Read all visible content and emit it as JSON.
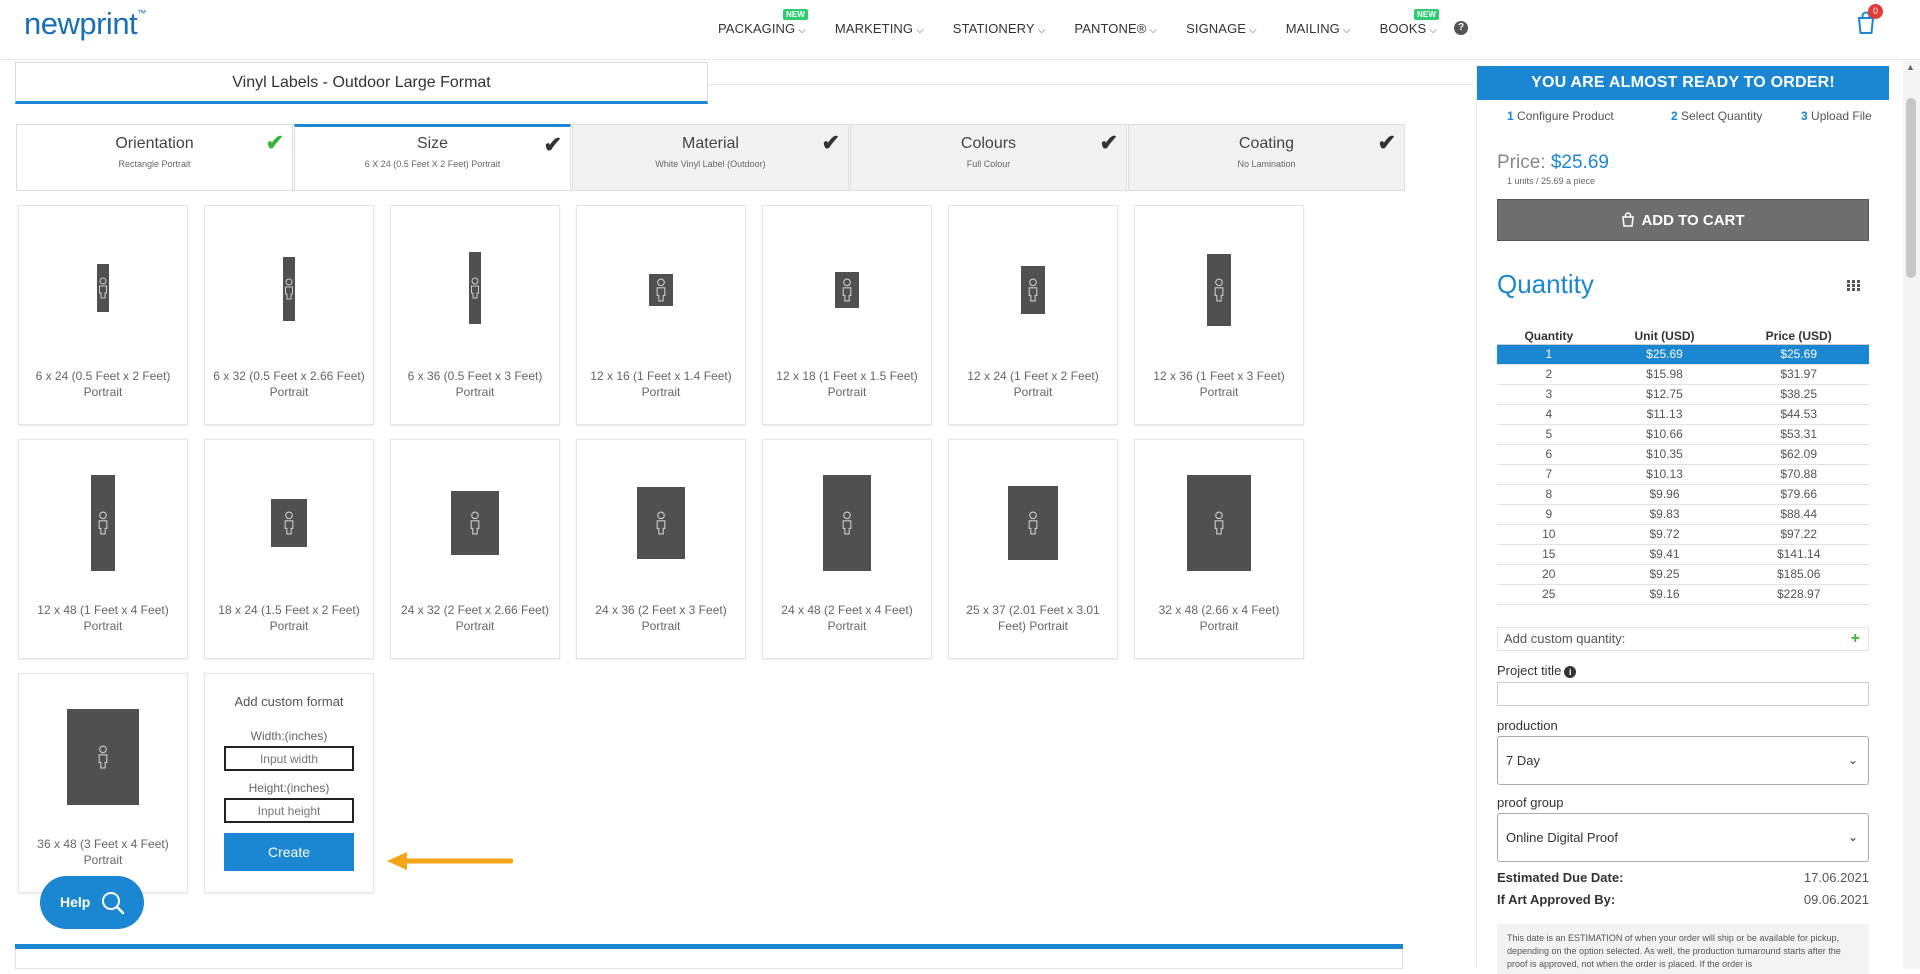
{
  "header": {
    "logo": "newprint",
    "logo_tm": "™",
    "nav": [
      {
        "label": "PACKAGING",
        "badge": "NEW"
      },
      {
        "label": "MARKETING",
        "badge": ""
      },
      {
        "label": "STATIONERY",
        "badge": ""
      },
      {
        "label": "PANTONE®",
        "badge": ""
      },
      {
        "label": "SIGNAGE",
        "badge": ""
      },
      {
        "label": "MAILING",
        "badge": ""
      },
      {
        "label": "BOOKS",
        "badge": "NEW"
      }
    ],
    "help_icon": "?",
    "cart_count": "0"
  },
  "product": {
    "title": "Vinyl Labels - Outdoor Large Format"
  },
  "steps": [
    {
      "title": "Orientation",
      "sub": "Rectangle Portrait"
    },
    {
      "title": "Size",
      "sub": "6 X 24 (0.5 Feet X 2 Feet) Portrait"
    },
    {
      "title": "Material",
      "sub": "White Vinyl Label (Outdoor)"
    },
    {
      "title": "Colours",
      "sub": "Full Colour"
    },
    {
      "title": "Coating",
      "sub": "No Lamination"
    }
  ],
  "sizes": [
    {
      "line1": "6 x 24 (0.5 Feet x 2 Feet)",
      "line2": "Portrait"
    },
    {
      "line1": "6 x 32 (0.5 Feet x 2.66 Feet)",
      "line2": "Portrait"
    },
    {
      "line1": "6 x 36 (0.5 Feet x 3 Feet)",
      "line2": "Portrait"
    },
    {
      "line1": "12 x 16 (1 Feet x 1.4 Feet)",
      "line2": "Portrait"
    },
    {
      "line1": "12 x 18 (1 Feet x 1.5 Feet)",
      "line2": "Portrait"
    },
    {
      "line1": "12 x 24 (1 Feet x 2 Feet)",
      "line2": "Portrait"
    },
    {
      "line1": "12 x 36 (1 Feet x 3 Feet)",
      "line2": "Portrait"
    },
    {
      "line1": "12 x 48 (1 Feet x 4 Feet)",
      "line2": "Portrait"
    },
    {
      "line1": "18 x 24 (1.5 Feet x 2 Feet)",
      "line2": "Portrait"
    },
    {
      "line1": "24 x 32 (2 Feet x 2.66 Feet)",
      "line2": "Portrait"
    },
    {
      "line1": "24 x 36 (2 Feet x 3 Feet)",
      "line2": "Portrait"
    },
    {
      "line1": "24 x 48 (2 Feet x 4 Feet)",
      "line2": "Portrait"
    },
    {
      "line1": "25 x 37 (2.01 Feet x 3.01",
      "line2": "Feet) Portrait"
    },
    {
      "line1": "32 x 48 (2.66 x 4 Feet)",
      "line2": "Portrait"
    },
    {
      "line1": "36 x 48 (3 Feet x 4 Feet)",
      "line2": "Portrait"
    }
  ],
  "custom_format": {
    "title": "Add custom format",
    "width_label": "Width:(inches)",
    "width_placeholder": "Input width",
    "height_label": "Height:(inches)",
    "height_placeholder": "Input height",
    "create_label": "Create"
  },
  "help_button": "Help",
  "order_panel": {
    "header": "YOU ARE ALMOST READY TO ORDER!",
    "steps": [
      {
        "num": "1",
        "label": "Configure Product"
      },
      {
        "num": "2",
        "label": "Select Quantity"
      },
      {
        "num": "3",
        "label": "Upload File"
      }
    ],
    "price_label": "Price:",
    "price_value": "$25.69",
    "price_sub": "1 units / 25.69 a piece",
    "add_to_cart": "ADD TO CART",
    "quantity_title": "Quantity",
    "table_headers": [
      "Quantity",
      "Unit (USD)",
      "Price (USD)"
    ],
    "rows": [
      [
        "1",
        "$25.69",
        "$25.69"
      ],
      [
        "2",
        "$15.98",
        "$31.97"
      ],
      [
        "3",
        "$12.75",
        "$38.25"
      ],
      [
        "4",
        "$11.13",
        "$44.53"
      ],
      [
        "5",
        "$10.66",
        "$53.31"
      ],
      [
        "6",
        "$10.35",
        "$62.09"
      ],
      [
        "7",
        "$10.13",
        "$70.88"
      ],
      [
        "8",
        "$9.96",
        "$79.66"
      ],
      [
        "9",
        "$9.83",
        "$88.44"
      ],
      [
        "10",
        "$9.72",
        "$97.22"
      ],
      [
        "15",
        "$9.41",
        "$141.14"
      ],
      [
        "20",
        "$9.25",
        "$185.06"
      ],
      [
        "25",
        "$9.16",
        "$228.97"
      ]
    ],
    "custom_quantity": "Add custom quantity:",
    "project_title_label": "Project title",
    "production_label": "production",
    "production_value": "7 Day",
    "proof_label": "proof group",
    "proof_value": "Online Digital Proof",
    "due_label": "Estimated Due Date:",
    "due_value": "17.06.2021",
    "approved_label": "If Art Approved By:",
    "approved_value": "09.06.2021",
    "note": "This date is an ESTIMATION of when your order will ship or be available for pickup, depending on the option selected. As well, the production turnaround starts after the proof is approved, not when the order is placed. If the order is"
  },
  "colors": {
    "accent": "#1b87d2",
    "check_green": "#3bb53b",
    "arrow": "#f2a516",
    "shape": "#505050"
  }
}
